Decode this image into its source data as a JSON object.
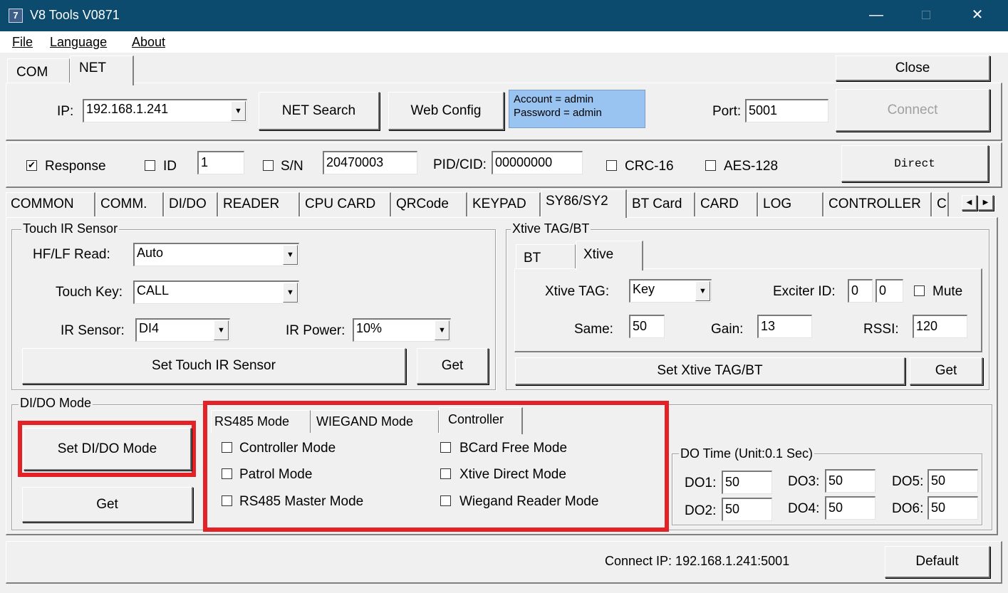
{
  "window": {
    "title": "V8 Tools V0871",
    "icon_text": "7",
    "minimize": "—",
    "maximize": "□",
    "close": "✕"
  },
  "menu": {
    "file": "File",
    "language": "Language",
    "about": "About"
  },
  "conn_tabs": {
    "com": "COM",
    "net": "NET"
  },
  "close_button": "Close",
  "net": {
    "ip_label": "IP:",
    "ip_value": "192.168.1.241",
    "search_button": "NET Search",
    "web_config_button": "Web Config",
    "account_line": "Account = admin",
    "password_line": "Password = admin",
    "port_label": "Port:",
    "port_value": "5001",
    "connect_button": "Connect"
  },
  "options": {
    "response_label": "Response",
    "response_checked": true,
    "id_label": "ID",
    "id_value": "1",
    "sn_label": "S/N",
    "sn_value": "20470003",
    "pidcid_label": "PID/CID:",
    "pidcid_value": "00000000",
    "crc_label": "CRC-16",
    "aes_label": "AES-128",
    "direct_button": "Direct"
  },
  "main_tabs": [
    "COMMON",
    "COMM.",
    "DI/DO",
    "READER",
    "CPU CARD",
    "QRCode",
    "KEYPAD",
    "SY86/SY2",
    "BT Card",
    "CARD",
    "LOG",
    "CONTROLLER",
    "C"
  ],
  "touch_ir": {
    "legend": "Touch IR Sensor",
    "hflf_label": "HF/LF Read:",
    "hflf_value": "Auto",
    "touch_key_label": "Touch Key:",
    "touch_key_value": "CALL",
    "ir_sensor_label": "IR Sensor:",
    "ir_sensor_value": "DI4",
    "ir_power_label": "IR Power:",
    "ir_power_value": "10%",
    "set_button": "Set Touch IR Sensor",
    "get_button": "Get"
  },
  "xtive": {
    "legend": "Xtive TAG/BT",
    "tab_bt": "BT",
    "tab_xtive": "Xtive",
    "tag_label": "Xtive TAG:",
    "tag_value": "Key",
    "exciter_label": "Exciter ID:",
    "exciter_1": "0",
    "exciter_2": "0",
    "mute_label": "Mute",
    "same_label": "Same:",
    "same_value": "50",
    "gain_label": "Gain:",
    "gain_value": "13",
    "rssi_label": "RSSI:",
    "rssi_value": "120",
    "set_button": "Set Xtive TAG/BT",
    "get_button": "Get"
  },
  "dido": {
    "legend": "DI/DO Mode",
    "set_button": "Set DI/DO Mode",
    "get_button": "Get",
    "tabs": [
      "RS485 Mode",
      "WIEGAND Mode",
      "Controller"
    ],
    "checks_left": [
      "Controller Mode",
      "Patrol Mode",
      "RS485 Master Mode"
    ],
    "checks_right": [
      "BCard Free Mode",
      "Xtive Direct Mode",
      "Wiegand Reader Mode"
    ],
    "do_time_legend": "DO Time (Unit:0.1 Sec)",
    "do1_label": "DO1:",
    "do1": "50",
    "do2_label": "DO2:",
    "do2": "50",
    "do3_label": "DO3:",
    "do3": "50",
    "do4_label": "DO4:",
    "do4": "50",
    "do5_label": "DO5:",
    "do5": "50",
    "do6_label": "DO6:",
    "do6": "50"
  },
  "status": {
    "connect_ip": "Connect IP: 192.168.1.241:5001",
    "default_button": "Default"
  },
  "colors": {
    "titlebar": "#0c4a6e",
    "account_box": "#99c4f2",
    "highlight": "#e32228"
  }
}
